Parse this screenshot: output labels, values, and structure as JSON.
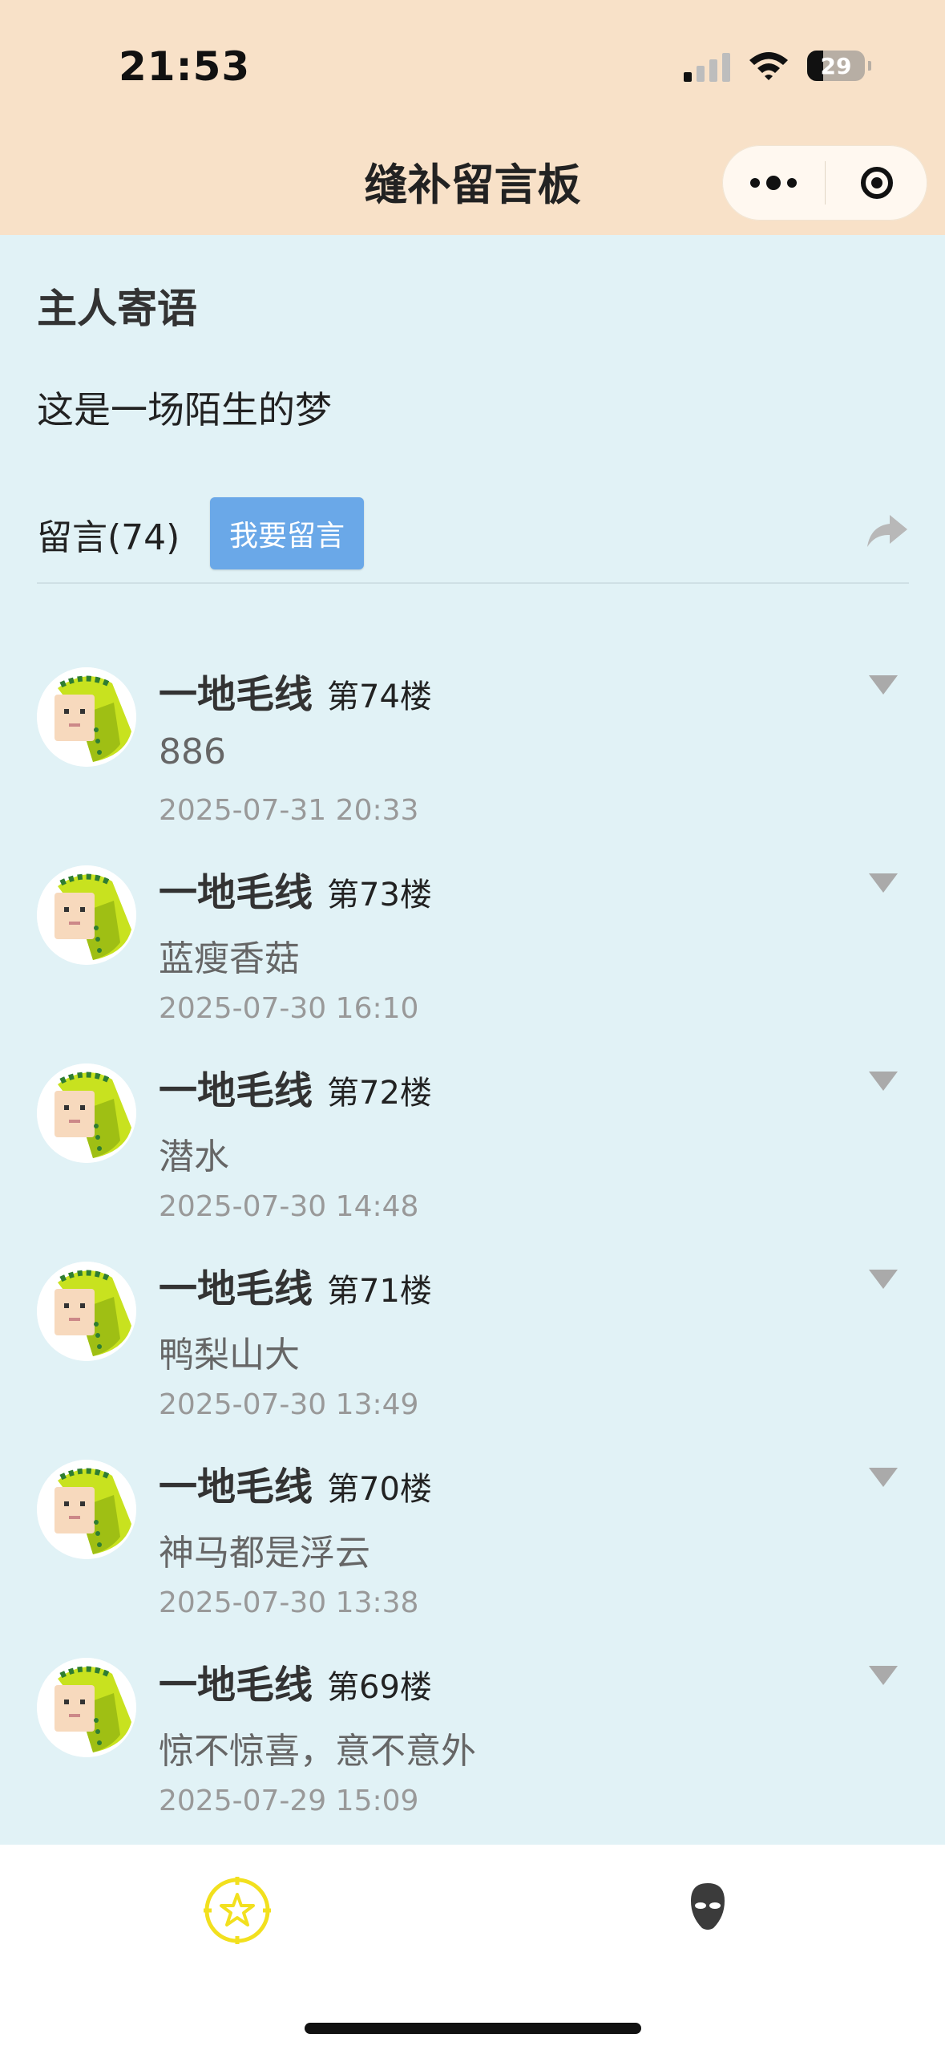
{
  "status_bar": {
    "time": "21:53",
    "battery": "29"
  },
  "header": {
    "title": "缝补留言板"
  },
  "intro": {
    "section_title": "主人寄语",
    "message": "这是一场陌生的梦"
  },
  "messages_bar": {
    "count_label": "留言(74)",
    "write_button": "我要留言"
  },
  "comments": [
    {
      "name": "一地毛线",
      "floor": "第74楼",
      "content": "886",
      "date": "2025-07-31 20:33"
    },
    {
      "name": "一地毛线",
      "floor": "第73楼",
      "content": "蓝瘦香菇",
      "date": "2025-07-30 16:10"
    },
    {
      "name": "一地毛线",
      "floor": "第72楼",
      "content": "潜水",
      "date": "2025-07-30 14:48"
    },
    {
      "name": "一地毛线",
      "floor": "第71楼",
      "content": "鸭梨山大",
      "date": "2025-07-30 13:49"
    },
    {
      "name": "一地毛线",
      "floor": "第70楼",
      "content": "神马都是浮云",
      "date": "2025-07-30 13:38"
    },
    {
      "name": "一地毛线",
      "floor": "第69楼",
      "content": "惊不惊喜，意不意外",
      "date": "2025-07-29 15:09"
    }
  ],
  "colors": {
    "header_bg": "#f8e1c8",
    "page_bg": "#e1f2f6",
    "button_bg": "#6aa8e8",
    "tab_active": "#f5e320"
  },
  "icons": {
    "share": "share-arrow-icon",
    "more": "more-dots-icon",
    "close": "target-close-icon",
    "tab_home": "star-compass-icon",
    "tab_me": "mask-icon",
    "caret": "caret-down-icon"
  }
}
